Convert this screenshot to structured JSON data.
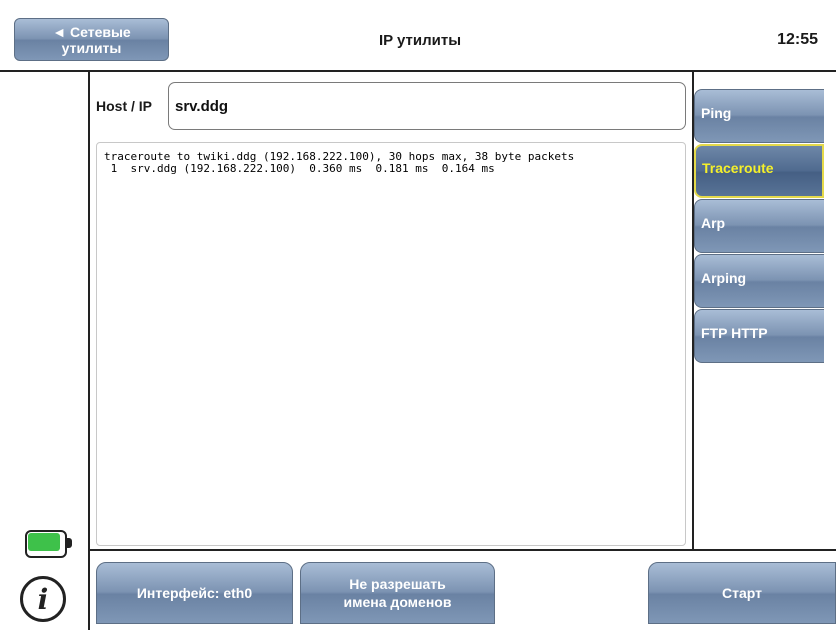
{
  "header": {
    "back_label_line1": "◄ Сетевые",
    "back_label_line2": "утилиты",
    "title": "IP утилиты",
    "clock": "12:55"
  },
  "host": {
    "label": "Host / IP",
    "value": "srv.ddg"
  },
  "output": {
    "lines": [
      "traceroute to twiki.ddg (192.168.222.100), 30 hops max, 38 byte packets",
      " 1  srv.ddg (192.168.222.100)  0.360 ms  0.181 ms  0.164 ms"
    ]
  },
  "tabs": [
    {
      "label": "Ping",
      "active": false
    },
    {
      "label": "Traceroute",
      "active": true
    },
    {
      "label": "Arp",
      "active": false
    },
    {
      "label": "Arping",
      "active": false
    },
    {
      "label": "FTP HTTP",
      "active": false
    }
  ],
  "footer": {
    "interface_label": "Интерфейс: eth0",
    "dns_line1": "Не разрешать",
    "dns_line2": "имена доменов",
    "start_label": "Старт"
  },
  "status": {
    "battery_icon": "battery-full-icon",
    "info_icon": "info-icon",
    "battery_color": "#3ec14a",
    "active_tab_text_color": "#f5f02a"
  }
}
